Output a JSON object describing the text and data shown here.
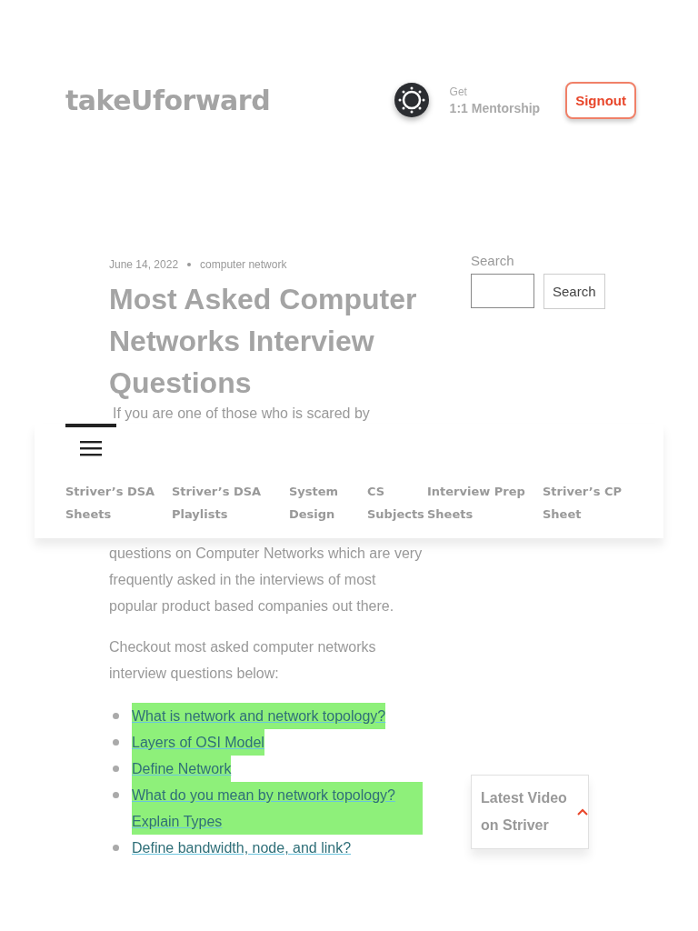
{
  "header": {
    "logo": "takeUforward",
    "mentorship": {
      "line_1": "Get",
      "line_2": "1:1 Mentorship"
    },
    "signout_button": "Signout"
  },
  "article": {
    "date": "June 14, 2022",
    "category": "computer network",
    "title": "Most Asked Computer Networks Interview Questions",
    "intro_start": "If you are one of those who is scared by"
  },
  "sidebar": {
    "search_label": "Search",
    "search_button": "Search"
  },
  "nav": {
    "items": [
      {
        "lines": [
          "Striver’s DSA",
          "Sheets"
        ]
      },
      {
        "lines": [
          "Striver’s DSA",
          "Playlists"
        ]
      },
      {
        "lines": [
          "System",
          "Design"
        ]
      },
      {
        "lines": [
          "CS",
          "Subjects"
        ]
      },
      {
        "lines": [
          "Interview Prep",
          "Sheets"
        ]
      },
      {
        "lines": [
          "Striver’s CP",
          "Sheet"
        ]
      }
    ]
  },
  "content": {
    "intro_end": "questions on Computer Networks which are very frequently asked in the interviews of most popular product based companies out there.",
    "lead": "Checkout most asked computer networks interview questions below:",
    "links": [
      {
        "text": "What is network and network topology?",
        "highlighted": true
      },
      {
        "text": "Layers of OSI Model",
        "highlighted": true
      },
      {
        "text": "Define Network",
        "highlighted": true
      },
      {
        "text": "What do you mean by network topology? Explain Types",
        "highlighted": true
      },
      {
        "text": "Define bandwidth, node, and link?",
        "highlighted": false
      }
    ],
    "latest_video": "Latest Video on Striver"
  }
}
